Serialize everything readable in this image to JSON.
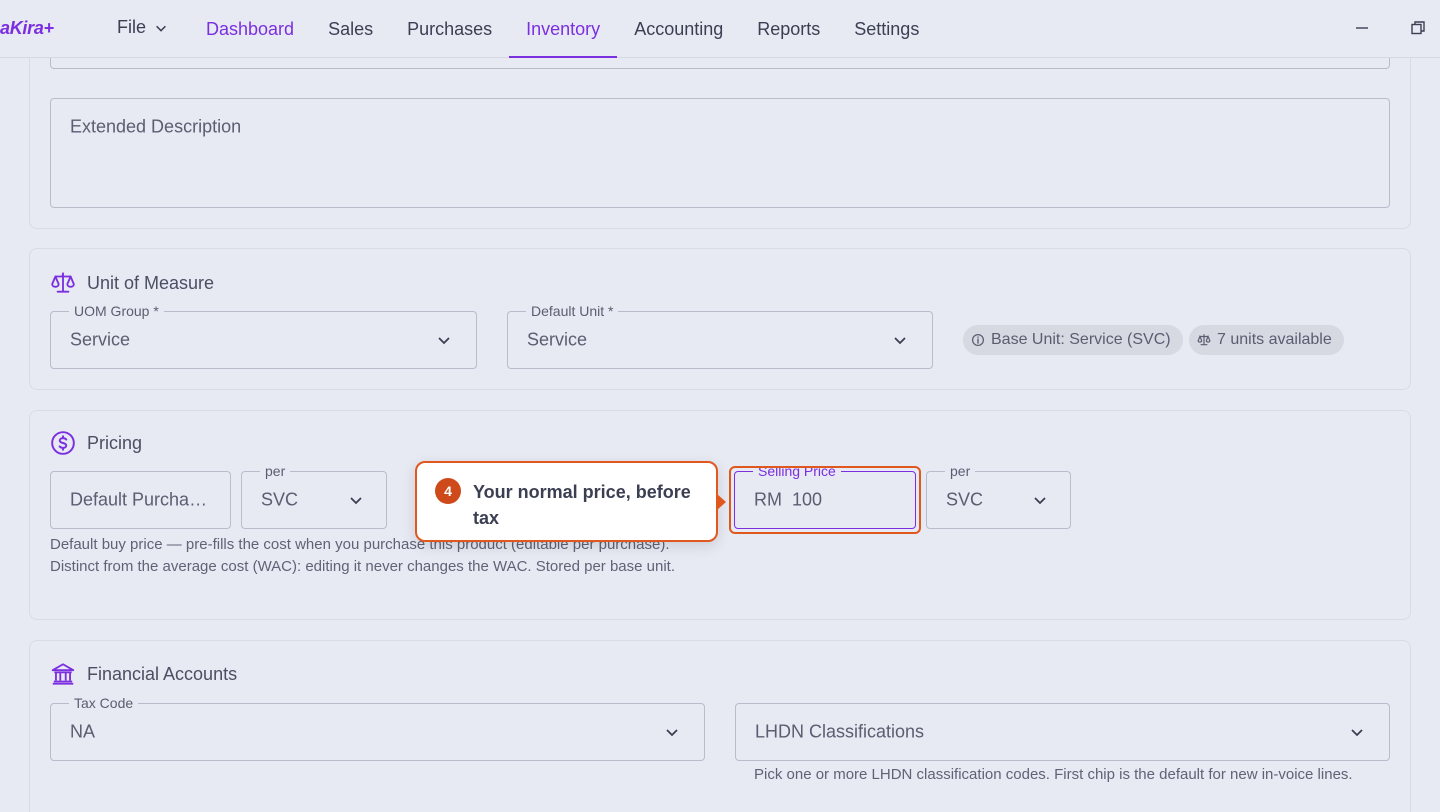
{
  "app": {
    "logo": "aKira+"
  },
  "menu": {
    "file_label": "File"
  },
  "nav": {
    "items": [
      {
        "label": "Dashboard"
      },
      {
        "label": "Sales"
      },
      {
        "label": "Purchases"
      },
      {
        "label": "Inventory"
      },
      {
        "label": "Accounting"
      },
      {
        "label": "Reports"
      },
      {
        "label": "Settings"
      }
    ],
    "active": "Inventory"
  },
  "description": {
    "extended_placeholder": "Extended Description"
  },
  "uom": {
    "title": "Unit of Measure",
    "group_label": "UOM Group *",
    "group_value": "Service",
    "default_unit_label": "Default Unit *",
    "default_unit_value": "Service",
    "base_unit_chip": "Base Unit: Service (SVC)",
    "units_chip": "7 units available"
  },
  "pricing": {
    "title": "Pricing",
    "purchase_placeholder": "Default Purcha…",
    "per_label": "per",
    "purchase_unit": "SVC",
    "selling_label": "Selling Price",
    "selling_value": "RM  100",
    "selling_unit": "SVC",
    "helper": "Default buy price — pre-fills the cost when you purchase this product (editable per purchase). Distinct from the average cost (WAC): editing it never changes the WAC. Stored per base unit."
  },
  "financial": {
    "title": "Financial Accounts",
    "tax_code_label": "Tax Code",
    "tax_code_value": "NA",
    "lhdn_placeholder": "LHDN Classifications",
    "lhdn_helper": "Pick one or more LHDN classification codes. First chip is the default for new in-voice lines."
  },
  "tour": {
    "step": "4",
    "text": "Your normal price, before tax"
  },
  "colors": {
    "accent": "#7b2fe0",
    "highlight": "#e1581e",
    "background": "#e7e9f3"
  }
}
